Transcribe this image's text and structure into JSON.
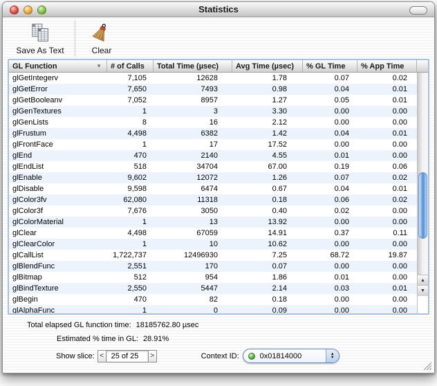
{
  "window": {
    "title": "Statistics"
  },
  "toolbar": {
    "save_label": "Save As Text",
    "clear_label": "Clear"
  },
  "table": {
    "columns": [
      {
        "label": "GL Function",
        "sorted": "desc"
      },
      {
        "label": "# of Calls"
      },
      {
        "label": "Total Time (µsec)"
      },
      {
        "label": "Avg Time (µsec)"
      },
      {
        "label": "% GL Time"
      },
      {
        "label": "% App Time"
      }
    ],
    "rows": [
      {
        "func": "glGetIntegerv",
        "calls": "7,105",
        "total": "12628",
        "avg": "1.78",
        "gl": "0.07",
        "app": "0.02"
      },
      {
        "func": "glGetError",
        "calls": "7,650",
        "total": "7493",
        "avg": "0.98",
        "gl": "0.04",
        "app": "0.01"
      },
      {
        "func": "glGetBooleanv",
        "calls": "7,052",
        "total": "8957",
        "avg": "1.27",
        "gl": "0.05",
        "app": "0.01"
      },
      {
        "func": "glGenTextures",
        "calls": "1",
        "total": "3",
        "avg": "3.30",
        "gl": "0.00",
        "app": "0.00"
      },
      {
        "func": "glGenLists",
        "calls": "8",
        "total": "16",
        "avg": "2.12",
        "gl": "0.00",
        "app": "0.00"
      },
      {
        "func": "glFrustum",
        "calls": "4,498",
        "total": "6382",
        "avg": "1.42",
        "gl": "0.04",
        "app": "0.01"
      },
      {
        "func": "glFrontFace",
        "calls": "1",
        "total": "17",
        "avg": "17.52",
        "gl": "0.00",
        "app": "0.00"
      },
      {
        "func": "glEnd",
        "calls": "470",
        "total": "2140",
        "avg": "4.55",
        "gl": "0.01",
        "app": "0.00"
      },
      {
        "func": "glEndList",
        "calls": "518",
        "total": "34704",
        "avg": "67.00",
        "gl": "0.19",
        "app": "0.06"
      },
      {
        "func": "glEnable",
        "calls": "9,602",
        "total": "12072",
        "avg": "1.26",
        "gl": "0.07",
        "app": "0.02"
      },
      {
        "func": "glDisable",
        "calls": "9,598",
        "total": "6474",
        "avg": "0.67",
        "gl": "0.04",
        "app": "0.01"
      },
      {
        "func": "glColor3fv",
        "calls": "62,080",
        "total": "11318",
        "avg": "0.18",
        "gl": "0.06",
        "app": "0.02"
      },
      {
        "func": "glColor3f",
        "calls": "7,676",
        "total": "3050",
        "avg": "0.40",
        "gl": "0.02",
        "app": "0.00"
      },
      {
        "func": "glColorMaterial",
        "calls": "1",
        "total": "13",
        "avg": "13.92",
        "gl": "0.00",
        "app": "0.00"
      },
      {
        "func": "glClear",
        "calls": "4,498",
        "total": "67059",
        "avg": "14.91",
        "gl": "0.37",
        "app": "0.11"
      },
      {
        "func": "glClearColor",
        "calls": "1",
        "total": "10",
        "avg": "10.62",
        "gl": "0.00",
        "app": "0.00"
      },
      {
        "func": "glCallList",
        "calls": "1,722,737",
        "total": "12496930",
        "avg": "7.25",
        "gl": "68.72",
        "app": "19.87"
      },
      {
        "func": "glBlendFunc",
        "calls": "2,551",
        "total": "170",
        "avg": "0.07",
        "gl": "0.00",
        "app": "0.00"
      },
      {
        "func": "glBitmap",
        "calls": "512",
        "total": "954",
        "avg": "1.86",
        "gl": "0.01",
        "app": "0.00"
      },
      {
        "func": "glBindTexture",
        "calls": "2,550",
        "total": "5447",
        "avg": "2.14",
        "gl": "0.03",
        "app": "0.01"
      },
      {
        "func": "glBegin",
        "calls": "470",
        "total": "82",
        "avg": "0.18",
        "gl": "0.00",
        "app": "0.00"
      },
      {
        "func": "glAlphaFunc",
        "calls": "1",
        "total": "0",
        "avg": "0.09",
        "gl": "0.00",
        "app": "0.00"
      }
    ]
  },
  "footer": {
    "total_label": "Total elapsed GL function time:",
    "total_value": "18185762.80 µsec",
    "estimated_label": "Estimated % time in GL:",
    "estimated_value": "28.91%",
    "show_slice_label": "Show slice:",
    "slice_prev": "<",
    "slice_value": "25 of 25",
    "slice_next": ">",
    "context_label": "Context ID:",
    "context_value": "0x01814000"
  },
  "icons": {
    "sort_desc": "▼",
    "scroll_up": "▲",
    "scroll_down": "▼",
    "popup_up": "▲",
    "popup_down": "▼"
  },
  "colors": {
    "row_stripe": "#edf3fd",
    "scrollbar_thumb": "#4b8ede",
    "table_focus_ring": "#a7c1dd",
    "context_status": "#54b236",
    "light_red": "#e05048",
    "light_yellow": "#eda93f",
    "light_green": "#82c244"
  }
}
